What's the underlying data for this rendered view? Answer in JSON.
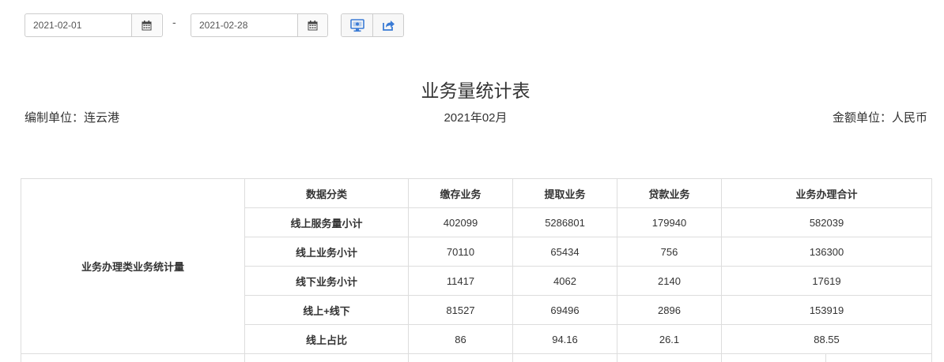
{
  "filters": {
    "start_date": "2021-02-01",
    "separator": "-",
    "end_date": "2021-02-28",
    "calendar_icon": "calendar-icon"
  },
  "toolbar": {
    "buttons": [
      {
        "icon": "monitor-icon"
      },
      {
        "icon": "share-export-icon"
      }
    ]
  },
  "report": {
    "title": "业务量统计表",
    "compiler": "编制单位：连云港",
    "period": "2021年02月",
    "currency": "金额单位：人民币"
  },
  "table": {
    "group_label": "业务办理类业务统计量",
    "headers": [
      "数据分类",
      "缴存业务",
      "提取业务",
      "贷款业务",
      "业务办理合计"
    ],
    "rows": [
      {
        "label": "线上服务量小计",
        "values": [
          "402099",
          "5286801",
          "179940",
          "582039"
        ]
      },
      {
        "label": "线上业务小计",
        "values": [
          "70110",
          "65434",
          "756",
          "136300"
        ]
      },
      {
        "label": "线下业务小计",
        "values": [
          "11417",
          "4062",
          "2140",
          "17619"
        ]
      },
      {
        "label": "线上+线下",
        "values": [
          "81527",
          "69496",
          "2896",
          "153919"
        ]
      },
      {
        "label": "线上占比",
        "values": [
          "86",
          "94.16",
          "26.1",
          "88.55"
        ]
      }
    ]
  },
  "colors": {
    "border": "#dddddd",
    "icon_blue": "#3a7bd5",
    "text": "#333333"
  }
}
